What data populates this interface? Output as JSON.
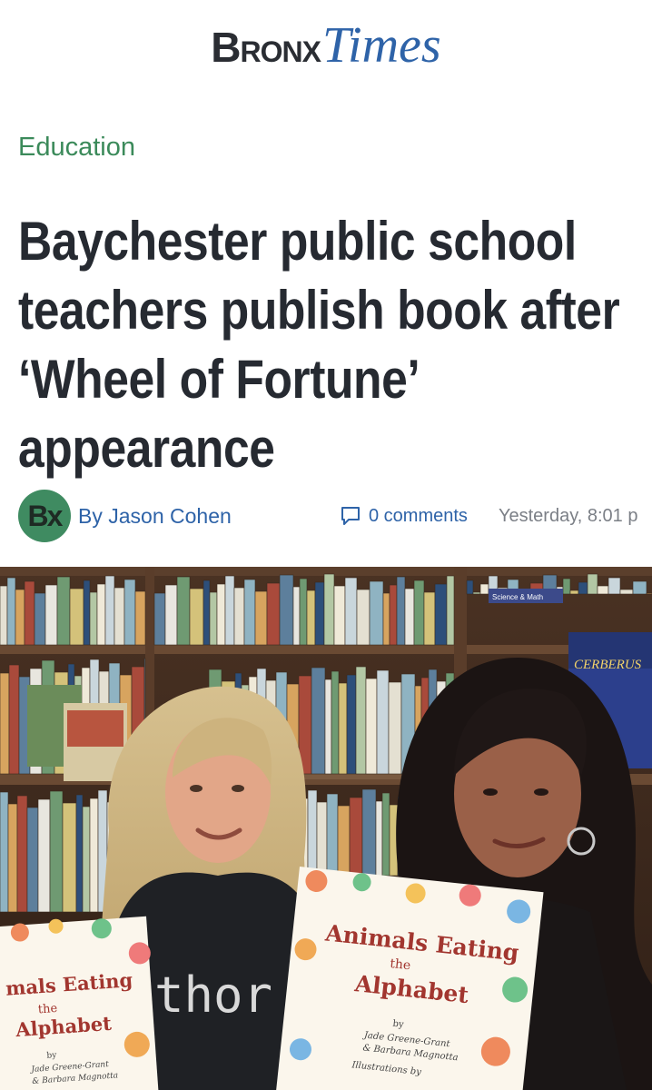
{
  "masthead": {
    "brand_first": "Bronx",
    "brand_second": "Times"
  },
  "article": {
    "category": "Education",
    "headline_lines": [
      "Baychester public school",
      "teachers publish book after",
      "‘Wheel of Fortune’",
      "appearance"
    ],
    "avatar_initials": "Bx",
    "author": "By Jason Cohen",
    "comments": "0 comments",
    "date": "Yesterday, 8:01 p"
  },
  "photo": {
    "book_left": {
      "line1": "mals Eating",
      "line2": "the",
      "line3": "Alphabet",
      "by": "by",
      "authors": "Jade Greene-Grant",
      "authors2": "& Barbara Magnotta"
    },
    "book_right": {
      "line1": "Animals Eating",
      "line2": "the",
      "line3": "Alphabet",
      "by": "by",
      "authors": "Jade Greene-Grant",
      "authors2": "& Barbara Magnotta",
      "illus": "Illustrations by"
    },
    "shirt_text": "thor",
    "shelf_book": "CERBERUS",
    "shelf_sign": "Science & Math"
  },
  "colors": {
    "brand_dark": "#2a2d33",
    "brand_blue": "#2e63a8",
    "category_green": "#3b8a5a",
    "avatar_green": "#3f8b61",
    "date_gray": "#7b7f86"
  }
}
